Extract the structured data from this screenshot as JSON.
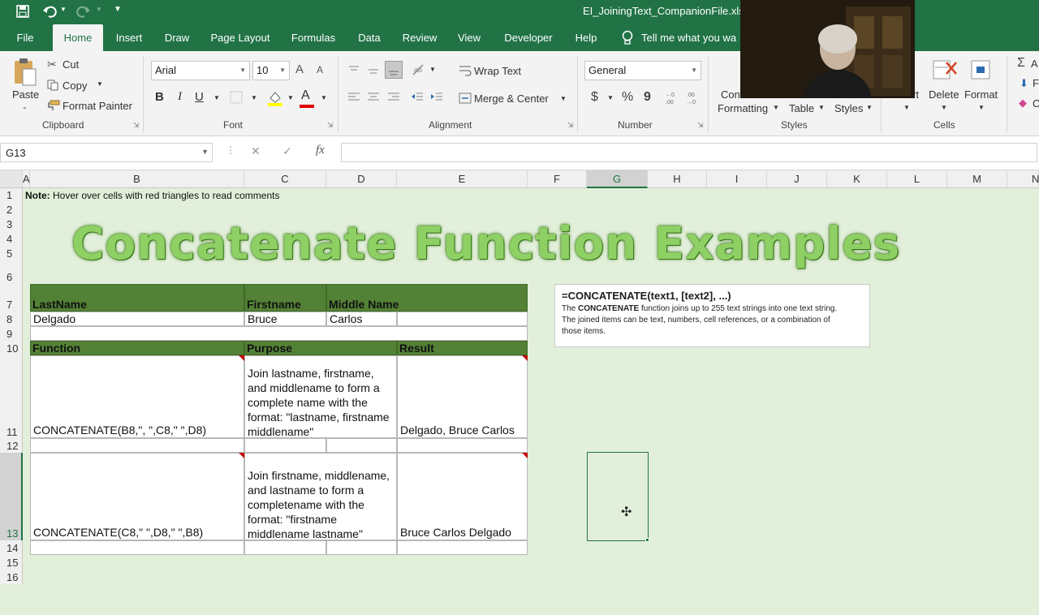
{
  "titlebar": {
    "filename": "EI_JoiningText_CompanionFile.xlsx",
    "qat": [
      "save-icon",
      "undo-icon",
      "redo-icon",
      "customize-icon"
    ]
  },
  "tabs": [
    "File",
    "Home",
    "Insert",
    "Draw",
    "Page Layout",
    "Formulas",
    "Data",
    "Review",
    "View",
    "Developer",
    "Help"
  ],
  "tell_me": "Tell me what you wa",
  "ribbon": {
    "clipboard": {
      "paste": "Paste",
      "cut": "Cut",
      "copy": "Copy",
      "format_painter": "Format Painter",
      "label": "Clipboard"
    },
    "font": {
      "name": "Arial",
      "size": "10",
      "bold": "B",
      "italic": "I",
      "underline": "U",
      "grow": "A",
      "shrink": "A",
      "font_color": "A",
      "label": "Font"
    },
    "alignment": {
      "wrap": "Wrap Text",
      "merge": "Merge & Center",
      "label": "Alignment"
    },
    "number": {
      "format": "General",
      "currency": "$",
      "percent": "%",
      "comma": "9",
      "label": "Number"
    },
    "styles": {
      "cond": "Con",
      "cond2": "Formatting",
      "table": "Table",
      "styles": "Styles",
      "label": "Styles"
    },
    "cells": {
      "insert": "rt",
      "delete": "Delete",
      "format": "Format",
      "label": "Cells"
    }
  },
  "formula_bar": {
    "name_box": "G13",
    "cancel": "✕",
    "enter": "✓",
    "fx": "fx",
    "value": ""
  },
  "columns": [
    "A",
    "B",
    "C",
    "D",
    "E",
    "F",
    "G",
    "H",
    "I",
    "J",
    "K",
    "L",
    "M",
    "N"
  ],
  "rows": [
    "1",
    "2",
    "3",
    "4",
    "5",
    "6",
    "7",
    "8",
    "9",
    "10",
    "11",
    "12",
    "13",
    "14",
    "15",
    "16"
  ],
  "note": {
    "label": "Note:",
    "text": " Hover over cells with red triangles to read comments"
  },
  "title": "Concatenate Function Examples",
  "name_table": {
    "headers": [
      "LastName",
      "Firstname",
      "Middle Name"
    ],
    "values": [
      "Delgado",
      "Bruce",
      "Carlos"
    ]
  },
  "func_table": {
    "headers": [
      "Function",
      "Purpose",
      "Result"
    ],
    "rows": [
      {
        "function": "CONCATENATE(B8,\", \",C8,\" \",D8)",
        "purpose": [
          "Join lastname, firstname,",
          "and middlename to form a",
          "complete name with the",
          "format: \"lastname, firstname",
          "middlename\""
        ],
        "result": "Delgado, Bruce Carlos"
      },
      {
        "function": "CONCATENATE(C8,\" \",D8,\" \",B8)",
        "purpose": [
          "Join firstname, middlename,",
          "and lastname to form a",
          "completename with the",
          "format: \"firstname",
          "middlename lastname\""
        ],
        "result": "Bruce Carlos Delgado"
      }
    ]
  },
  "info": {
    "syntax": "=CONCATENATE(text1, [text2], ...)",
    "pre": "The ",
    "bold": "CONCATENATE",
    "post": " function joins up to 255 text strings into one text string.",
    "line2": "The joined items can be text, numbers, cell references, or a combination of",
    "line3": "those items."
  },
  "colors": {
    "excel_green": "#217346",
    "header_green": "#538135",
    "sheet_bg": "#e2efda",
    "title_green": "#8fd065"
  }
}
